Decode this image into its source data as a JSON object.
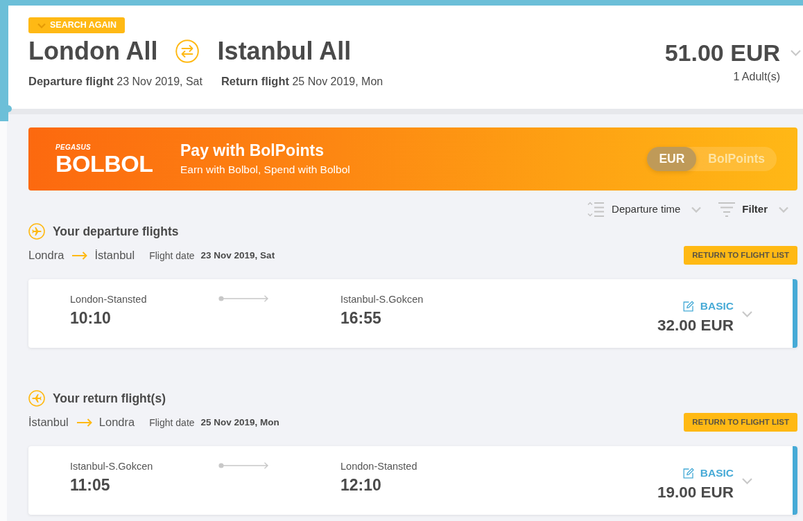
{
  "header": {
    "search_again": "SEARCH AGAIN",
    "origin": "London All",
    "destination": "Istanbul All",
    "departure": {
      "label": "Departure flight",
      "date": "23 Nov 2019, Sat"
    },
    "return": {
      "label": "Return flight",
      "date": "25 Nov 2019, Mon"
    },
    "total_price": "51.00 EUR",
    "passengers": "1 Adult(s)"
  },
  "promo": {
    "brand": "PEGASUS",
    "logo": "BOLBOL",
    "title": "Pay with BolPoints",
    "subtitle": "Earn with Bolbol, Spend with Bolbol",
    "currency_toggle": [
      {
        "label": "EUR",
        "selected": true
      },
      {
        "label": "BolPoints",
        "selected": false
      }
    ]
  },
  "toolbar": {
    "sort": "Departure time",
    "filter": "Filter"
  },
  "sections": [
    {
      "kind": "departure",
      "title": "Your departure flights",
      "from": "Londra",
      "to": "İstanbul",
      "date_label": "Flight date",
      "date": "23 Nov 2019, Sat",
      "return_button": "RETURN TO FLIGHT LIST",
      "flight": {
        "origin": "London-Stansted",
        "departure_time": "10:10",
        "destination": "Istanbul-S.Gokcen",
        "arrival_time": "16:55",
        "fare": "BASIC",
        "price": "32.00 EUR"
      }
    },
    {
      "kind": "return",
      "title": "Your return flight(s)",
      "from": "İstanbul",
      "to": "Londra",
      "date_label": "Flight date",
      "date": "25 Nov 2019, Mon",
      "return_button": "RETURN TO FLIGHT LIST",
      "flight": {
        "origin": "Istanbul-S.Gokcen",
        "departure_time": "11:05",
        "destination": "London-Stansted",
        "arrival_time": "12:10",
        "fare": "BASIC",
        "price": "19.00 EUR"
      }
    }
  ]
}
